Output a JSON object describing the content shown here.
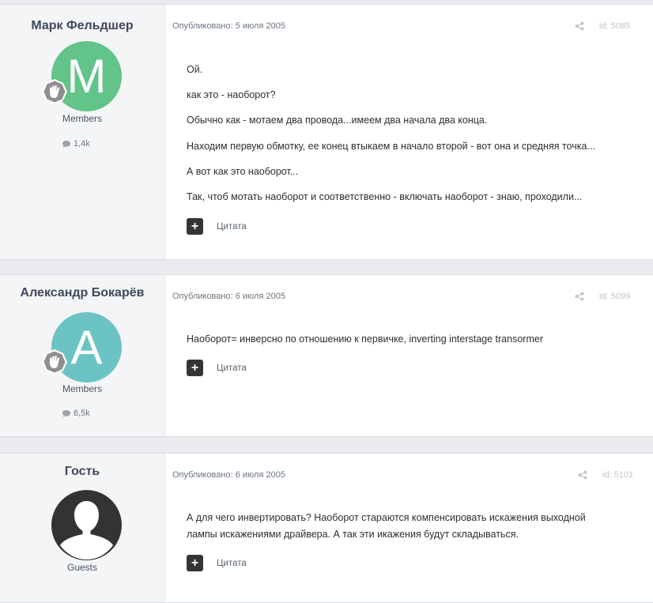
{
  "posts": [
    {
      "author": "Марк Фельдшер",
      "avatar_letter": "M",
      "avatar_color": "#62c488",
      "group": "Members",
      "post_count": "1,4k",
      "published": "Опубликовано: 5 июля 2005",
      "id_label": "id: 5085",
      "lines": [
        "Ой.",
        "как это - наоборот?",
        "Обычно как - мотаем два провода...имеем два начала два конца.",
        "Находим первую обмотку, ее конец втыкаем в начало второй - вот она и средняя точка...",
        "А вот как это наоборот...",
        "Так, чтоб мотать наоборот и соответственно - включать наоборот - знаю, проходили..."
      ],
      "quote_label": "Цитата"
    },
    {
      "author": "Александр Бокарёв",
      "avatar_letter": "A",
      "avatar_color": "#6cc3c4",
      "group": "Members",
      "post_count": "6,5k",
      "published": "Опубликовано: 6 июля 2005",
      "id_label": "id: 5099",
      "lines": [
        "Наоборот= инверсно по отношению к первичке, inverting interstage transormer"
      ],
      "quote_label": "Цитата"
    },
    {
      "author": "Гость",
      "group": "Guests",
      "published": "Опубликовано: 6 июля 2005",
      "id_label": "id: 5101",
      "lines": [
        "А для чего инвертировать? Наоборот стараются компенсировать искажения выходной",
        "лампы искажениями драйвера. А так эти икажения будут складываться."
      ],
      "quote_label": "Цитата"
    }
  ],
  "colors": {
    "page_bg": "#e9ebee",
    "author_panel_bg": "#f4f5f7",
    "guest_avatar_bg": "#333333"
  },
  "icons": {
    "rank": "hand-badge-icon",
    "posts": "speech-bubble-icon",
    "share": "share-icon",
    "add": "plus-icon",
    "guest_avatar": "user-silhouette-icon"
  }
}
